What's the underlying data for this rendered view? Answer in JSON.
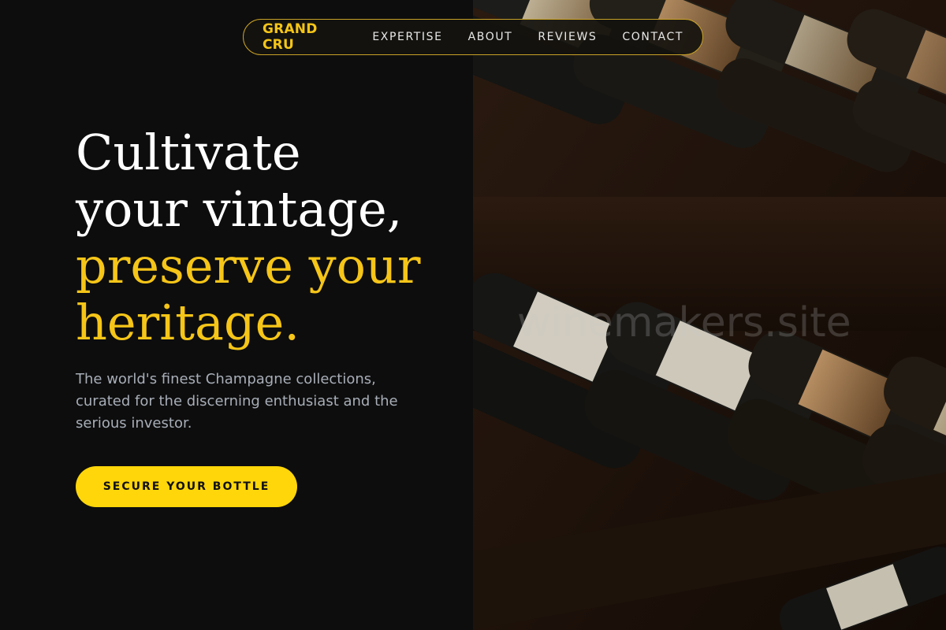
{
  "nav": {
    "brand": "GRAND CRU",
    "links": [
      "EXPERTISE",
      "ABOUT",
      "REVIEWS",
      "CONTACT"
    ]
  },
  "hero": {
    "headline_lines": [
      "Cultivate",
      "your vintage,"
    ],
    "headline_accent_lines": [
      "preserve your",
      "heritage."
    ],
    "subtitle": "The world's finest Champagne collections, curated for the discerning enthusiast and the serious investor.",
    "cta_label": "SECURE YOUR BOTTLE"
  },
  "watermark": "winemakers.site",
  "colors": {
    "accent": "#f5c518",
    "button": "#ffd60a",
    "background": "#0d0d0d",
    "text_muted": "#a8aeb8"
  }
}
